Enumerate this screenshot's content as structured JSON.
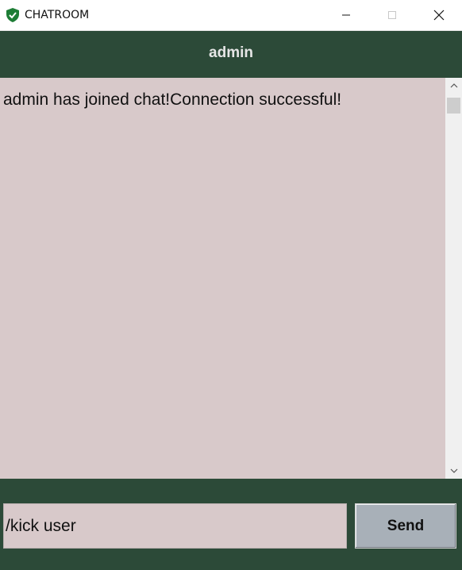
{
  "window": {
    "title": "CHATROOM",
    "icon": "shield-check-icon"
  },
  "header": {
    "username": "admin"
  },
  "chat": {
    "messages": [
      "admin has joined chat!Connection successful!"
    ]
  },
  "composer": {
    "input_value": "/kick user",
    "send_label": "Send"
  },
  "colors": {
    "panel_bg": "#2c4a38",
    "log_bg": "#d8c9ca",
    "send_bg": "#a8b0b8",
    "icon_green": "#1e7d36"
  }
}
